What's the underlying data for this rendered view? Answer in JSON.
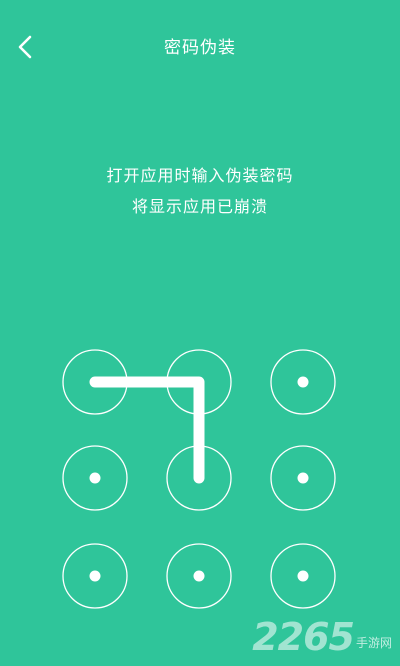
{
  "header": {
    "title": "密码伪装",
    "back_icon": "chevron-left-icon"
  },
  "instruction": {
    "line1": "打开应用时输入伪装密码",
    "line2": "将显示应用已崩溃"
  },
  "pattern": {
    "grid": "3x3",
    "path_nodes": [
      1,
      2,
      5
    ]
  },
  "watermark": {
    "number": "2265",
    "suffix": "手游网"
  },
  "colors": {
    "background": "#2fc59a",
    "foreground": "#ffffff"
  }
}
